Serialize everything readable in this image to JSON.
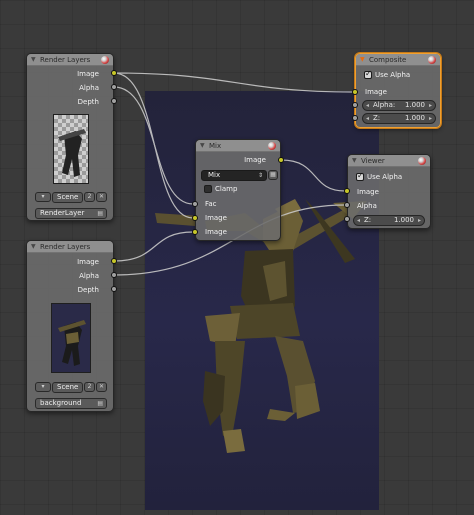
{
  "colors": {
    "backdrop": "#26263f",
    "link": "#c8c8c8",
    "socket_color": "#c7c729",
    "socket_value": "#a1a1a1",
    "active_outline": "#f0a030"
  },
  "render_layers_1": {
    "title": "Render Layers",
    "outputs": [
      "Image",
      "Alpha",
      "Depth"
    ],
    "scene": "Scene",
    "scene_users": "2",
    "layer": "RenderLayer"
  },
  "render_layers_2": {
    "title": "Render Layers",
    "outputs": [
      "Image",
      "Alpha",
      "Depth"
    ],
    "scene": "Scene",
    "scene_users": "2",
    "layer": "background"
  },
  "mix": {
    "title": "Mix",
    "output": "Image",
    "blend_mode": "Mix",
    "clamp_label": "Clamp",
    "inputs": [
      "Fac",
      "Image",
      "Image"
    ]
  },
  "composite": {
    "title": "Composite",
    "use_alpha_label": "Use Alpha",
    "input": "Image",
    "alpha_label": "Alpha:",
    "alpha_value": "1.000",
    "z_label": "Z:",
    "z_value": "1.000"
  },
  "viewer": {
    "title": "Viewer",
    "use_alpha_label": "Use Alpha",
    "inputs": [
      "Image",
      "Alpha"
    ],
    "z_label": "Z:",
    "z_value": "1.000"
  }
}
